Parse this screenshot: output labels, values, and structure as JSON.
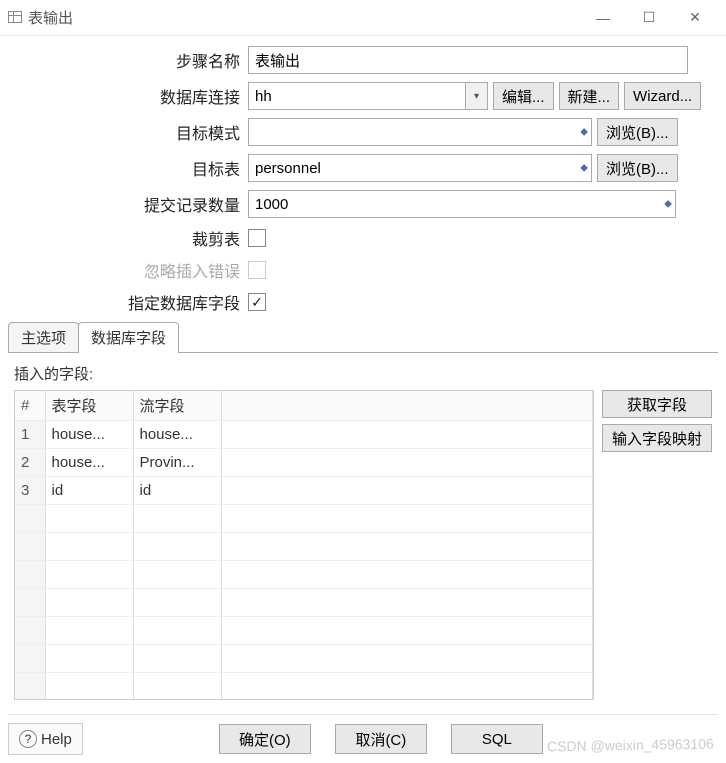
{
  "window": {
    "title": "表输出"
  },
  "form": {
    "step_name_label": "步骤名称",
    "step_name_value": "表输出",
    "db_conn_label": "数据库连接",
    "db_conn_value": "hh",
    "edit_btn": "编辑...",
    "new_btn": "新建...",
    "wizard_btn": "Wizard...",
    "target_schema_label": "目标模式",
    "target_schema_value": "",
    "browse_b_btn": "浏览(B)...",
    "target_table_label": "目标表",
    "target_table_value": "personnel",
    "commit_size_label": "提交记录数量",
    "commit_size_value": "1000",
    "truncate_label": "裁剪表",
    "ignore_insert_err_label": "忽略插入错误",
    "specify_fields_label": "指定数据库字段"
  },
  "tabs": {
    "main": "主选项",
    "db_fields": "数据库字段"
  },
  "fields_section": {
    "title": "插入的字段:",
    "get_fields_btn": "获取字段",
    "mapping_btn": "输入字段映射",
    "headers": {
      "num": "#",
      "table_field": "表字段",
      "stream_field": "流字段"
    },
    "rows": [
      {
        "n": "1",
        "table_field": "house...",
        "stream_field": "house..."
      },
      {
        "n": "2",
        "table_field": "house...",
        "stream_field": "Provin..."
      },
      {
        "n": "3",
        "table_field": "id",
        "stream_field": "id"
      }
    ]
  },
  "footer": {
    "help": "Help",
    "ok": "确定(O)",
    "cancel": "取消(C)",
    "sql": "SQL"
  },
  "watermark": "CSDN @weixin_45963106"
}
